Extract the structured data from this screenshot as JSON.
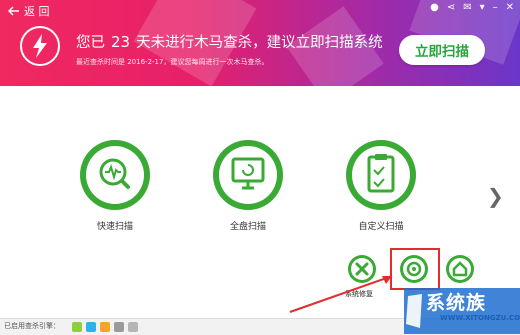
{
  "header": {
    "back_label": "返 回",
    "headline_prefix": "您已",
    "days": "23",
    "headline_suffix": "天未进行木马查杀，建议立即扫描系统",
    "subline": "最近查杀时间是 2016-2-17，建议您每周进行一次木马查杀。",
    "scan_button": "立即扫描"
  },
  "modes": [
    {
      "label": "快速扫描",
      "icon": "quick-scan-icon"
    },
    {
      "label": "全盘扫描",
      "icon": "full-scan-icon"
    },
    {
      "label": "自定义扫描",
      "icon": "custom-scan-icon"
    }
  ],
  "tools": {
    "repair_label": "系统修复"
  },
  "footer": {
    "engines_label": "已启用查杀引擎："
  },
  "watermark": {
    "brand": "系统族",
    "url": "WWW.XITONGZU.COM"
  },
  "colors": {
    "accent_green": "#3aaa35",
    "highlight_red": "#e02d2d"
  }
}
